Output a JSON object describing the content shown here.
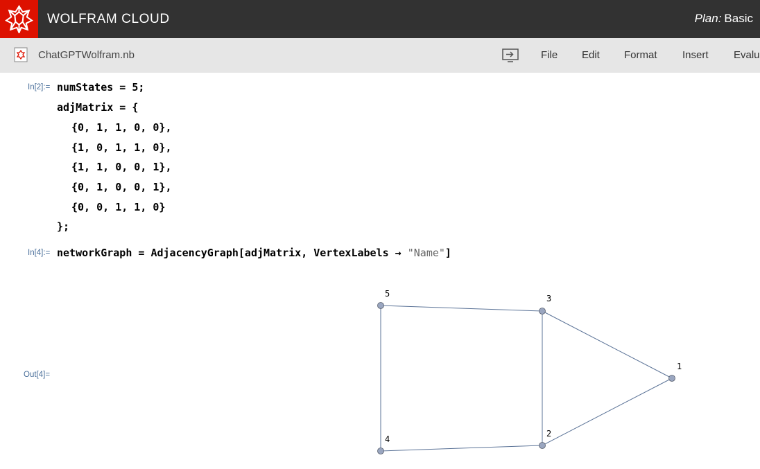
{
  "header": {
    "brand": "WOLFRAM CLOUD",
    "plan_label": "Plan:",
    "plan_value": "Basic",
    "logo_icon": "wolfram-spikey-icon"
  },
  "toolbar": {
    "notebook_name": "ChatGPTWolfram.nb",
    "menus": [
      "File",
      "Edit",
      "Format",
      "Insert",
      "Evalua"
    ]
  },
  "cells": {
    "in2_label": "In[2]:=",
    "in2_lines": [
      "numStates = 5;",
      "adjMatrix = {",
      "{0, 1, 1, 0, 0},",
      "{1, 0, 1, 1, 0},",
      "{1, 1, 0, 0, 1},",
      "{0, 1, 0, 0, 1},",
      "{0, 0, 1, 1, 0}",
      "};"
    ],
    "in4_label": "In[4]:=",
    "in4_code": "networkGraph = AdjacencyGraph[adjMatrix, VertexLabels → ",
    "in4_string": "\"Name\"",
    "in4_close": "]",
    "out4_label": "Out[4]="
  },
  "graph": {
    "vertices": [
      "1",
      "2",
      "3",
      "4",
      "5"
    ],
    "edges": [
      [
        "1",
        "2"
      ],
      [
        "1",
        "3"
      ],
      [
        "2",
        "3"
      ],
      [
        "2",
        "4"
      ],
      [
        "3",
        "5"
      ],
      [
        "4",
        "5"
      ]
    ],
    "vertex_color": "#9aa6c0",
    "edge_color": "#5b7397"
  }
}
